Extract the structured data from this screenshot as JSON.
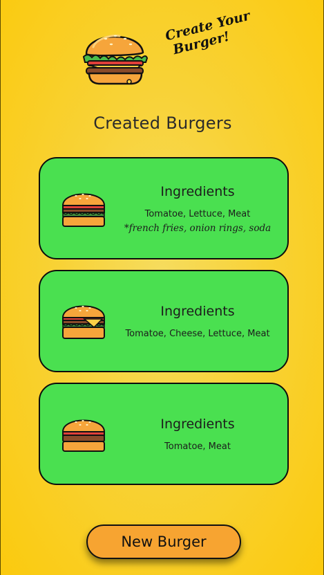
{
  "header": {
    "tagline_line1": "Create Your",
    "tagline_line2": "Burger!",
    "logo_icon": "burger-logo-icon"
  },
  "section_title": "Created Burgers",
  "burgers": [
    {
      "heading": "Ingredients",
      "ingredients": "Tomatoe, Lettuce, Meat",
      "extras": "*french fries, onion rings, soda",
      "icon": "burger-lettuce-icon"
    },
    {
      "heading": "Ingredients",
      "ingredients": "Tomatoe, Cheese, Lettuce, Meat",
      "icon": "burger-cheese-icon"
    },
    {
      "heading": "Ingredients",
      "ingredients": "Tomatoe, Meat",
      "icon": "burger-meat-icon"
    }
  ],
  "actions": {
    "new_burger_label": "New Burger"
  },
  "colors": {
    "background": "#f8d236",
    "card": "#4ae050",
    "button": "#f7a431"
  }
}
